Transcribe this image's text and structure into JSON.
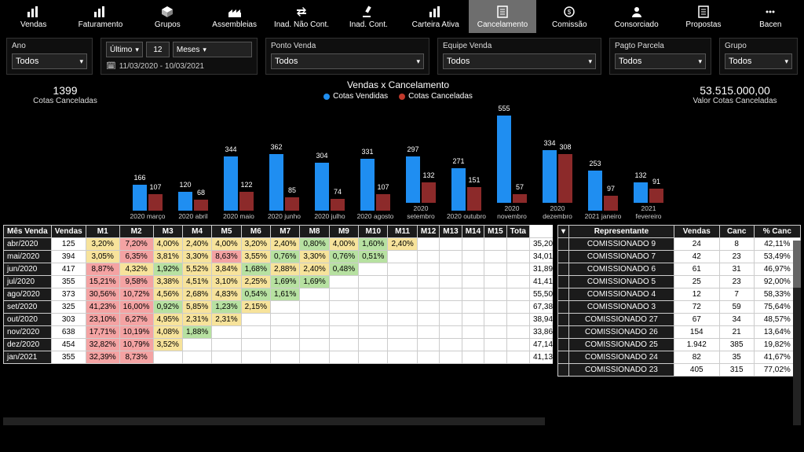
{
  "nav": [
    {
      "label": "Vendas",
      "icon": "bar"
    },
    {
      "label": "Faturamento",
      "icon": "bar"
    },
    {
      "label": "Grupos",
      "icon": "cube"
    },
    {
      "label": "Assembleias",
      "icon": "factory"
    },
    {
      "label": "Inad. Não Cont.",
      "icon": "swap"
    },
    {
      "label": "Inad. Cont.",
      "icon": "gavel"
    },
    {
      "label": "Carteira Ativa",
      "icon": "bar"
    },
    {
      "label": "Cancelamento",
      "icon": "doc",
      "active": true
    },
    {
      "label": "Comissão",
      "icon": "money"
    },
    {
      "label": "Consorciado",
      "icon": "user"
    },
    {
      "label": "Propostas",
      "icon": "doc"
    },
    {
      "label": "Bacen",
      "icon": "dots"
    }
  ],
  "filters": {
    "ano": {
      "title": "Ano",
      "value": "Todos"
    },
    "periodo": {
      "dropdown": "Último",
      "num": "12",
      "unit": "Meses",
      "date": "11/03/2020 - 10/03/2021"
    },
    "ponto": {
      "title": "Ponto Venda",
      "value": "Todos"
    },
    "equipe": {
      "title": "Equipe Venda",
      "value": "Todos"
    },
    "pagto": {
      "title": "Pagto Parcela",
      "value": "Todos"
    },
    "grupo": {
      "title": "Grupo",
      "value": "Todos"
    }
  },
  "kpi_left": {
    "value": "1399",
    "label": "Cotas Canceladas"
  },
  "kpi_right": {
    "value": "53.515.000,00",
    "label": "Valor Cotas Canceladas"
  },
  "chart_title": "Vendas x Cancelamento",
  "legend": {
    "a": "Cotas Vendidas",
    "b": "Cotas Canceladas"
  },
  "chart_data": {
    "type": "bar",
    "title": "Vendas x Cancelamento",
    "xlabel": "",
    "ylabel": "",
    "ylim": [
      0,
      600
    ],
    "categories": [
      "2020 março",
      "2020 abril",
      "2020 maio",
      "2020 junho",
      "2020 julho",
      "2020 agosto",
      "2020 setembro",
      "2020 outubro",
      "2020 novembro",
      "2020 dezembro",
      "2021 janeiro",
      "2021 fevereiro"
    ],
    "series": [
      {
        "name": "Cotas Vendidas",
        "color": "#1f8ef1",
        "values": [
          166,
          120,
          344,
          362,
          304,
          331,
          297,
          271,
          555,
          334,
          253,
          132
        ]
      },
      {
        "name": "Cotas Canceladas",
        "color": "#8c2a2a",
        "values": [
          107,
          68,
          122,
          85,
          74,
          107,
          132,
          151,
          57,
          308,
          97,
          91
        ]
      }
    ]
  },
  "left_table": {
    "headers": [
      "Mês Venda",
      "Vendas",
      "M1",
      "M2",
      "M3",
      "M4",
      "M5",
      "M6",
      "M7",
      "M8",
      "M9",
      "M10",
      "M11",
      "M12",
      "M13",
      "M14",
      "M15",
      "Tota"
    ],
    "rows": [
      {
        "mes": "abr/2020",
        "vendas": "125",
        "cells": [
          "3,20%",
          "7,20%",
          "4,00%",
          "2,40%",
          "4,00%",
          "3,20%",
          "2,40%",
          "0,80%",
          "4,00%",
          "1,60%",
          "2,40%",
          "",
          "",
          "",
          "",
          ""
        ],
        "total": "35,20"
      },
      {
        "mes": "mai/2020",
        "vendas": "394",
        "cells": [
          "3,05%",
          "6,35%",
          "3,81%",
          "3,30%",
          "8,63%",
          "3,55%",
          "0,76%",
          "3,30%",
          "0,76%",
          "0,51%",
          "",
          "",
          "",
          "",
          "",
          ""
        ],
        "total": "34,01"
      },
      {
        "mes": "jun/2020",
        "vendas": "417",
        "cells": [
          "8,87%",
          "4,32%",
          "1,92%",
          "5,52%",
          "3,84%",
          "1,68%",
          "2,88%",
          "2,40%",
          "0,48%",
          "",
          "",
          "",
          "",
          "",
          "",
          ""
        ],
        "total": "31,89"
      },
      {
        "mes": "jul/2020",
        "vendas": "355",
        "cells": [
          "15,21%",
          "9,58%",
          "3,38%",
          "4,51%",
          "3,10%",
          "2,25%",
          "1,69%",
          "1,69%",
          "",
          "",
          "",
          "",
          "",
          "",
          "",
          ""
        ],
        "total": "41,41"
      },
      {
        "mes": "ago/2020",
        "vendas": "373",
        "cells": [
          "30,56%",
          "10,72%",
          "4,56%",
          "2,68%",
          "4,83%",
          "0,54%",
          "1,61%",
          "",
          "",
          "",
          "",
          "",
          "",
          "",
          "",
          ""
        ],
        "total": "55,50"
      },
      {
        "mes": "set/2020",
        "vendas": "325",
        "cells": [
          "41,23%",
          "16,00%",
          "0,92%",
          "5,85%",
          "1,23%",
          "2,15%",
          "",
          "",
          "",
          "",
          "",
          "",
          "",
          "",
          "",
          ""
        ],
        "total": "67,38"
      },
      {
        "mes": "out/2020",
        "vendas": "303",
        "cells": [
          "23,10%",
          "6,27%",
          "4,95%",
          "2,31%",
          "2,31%",
          "",
          "",
          "",
          "",
          "",
          "",
          "",
          "",
          "",
          "",
          ""
        ],
        "total": "38,94"
      },
      {
        "mes": "nov/2020",
        "vendas": "638",
        "cells": [
          "17,71%",
          "10,19%",
          "4,08%",
          "1,88%",
          "",
          "",
          "",
          "",
          "",
          "",
          "",
          "",
          "",
          "",
          "",
          ""
        ],
        "total": "33,86"
      },
      {
        "mes": "dez/2020",
        "vendas": "454",
        "cells": [
          "32,82%",
          "10,79%",
          "3,52%",
          "",
          "",
          "",
          "",
          "",
          "",
          "",
          "",
          "",
          "",
          "",
          "",
          ""
        ],
        "total": "47,14"
      },
      {
        "mes": "jan/2021",
        "vendas": "355",
        "cells": [
          "32,39%",
          "8,73%",
          "",
          "",
          "",
          "",
          "",
          "",
          "",
          "",
          "",
          "",
          "",
          "",
          "",
          ""
        ],
        "total": "41,13"
      }
    ]
  },
  "right_table": {
    "headers": [
      "Representante",
      "Vendas",
      "Canc",
      "% Canc"
    ],
    "rows": [
      {
        "name": "COMISSIONADO 9",
        "v": "24",
        "c": "8",
        "p": "42,11%"
      },
      {
        "name": "COMISSIONADO 7",
        "v": "42",
        "c": "23",
        "p": "53,49%"
      },
      {
        "name": "COMISSIONADO 6",
        "v": "61",
        "c": "31",
        "p": "46,97%"
      },
      {
        "name": "COMISSIONADO 5",
        "v": "25",
        "c": "23",
        "p": "92,00%"
      },
      {
        "name": "COMISSIONADO 4",
        "v": "12",
        "c": "7",
        "p": "58,33%"
      },
      {
        "name": "COMISSIONADO 3",
        "v": "72",
        "c": "59",
        "p": "75,64%"
      },
      {
        "name": "COMISSIONADO 27",
        "v": "67",
        "c": "34",
        "p": "48,57%"
      },
      {
        "name": "COMISSIONADO 26",
        "v": "154",
        "c": "21",
        "p": "13,64%"
      },
      {
        "name": "COMISSIONADO 25",
        "v": "1.942",
        "c": "385",
        "p": "19,82%"
      },
      {
        "name": "COMISSIONADO 24",
        "v": "82",
        "c": "35",
        "p": "41,67%"
      },
      {
        "name": "COMISSIONADO 23",
        "v": "405",
        "c": "315",
        "p": "77,02%"
      }
    ]
  }
}
